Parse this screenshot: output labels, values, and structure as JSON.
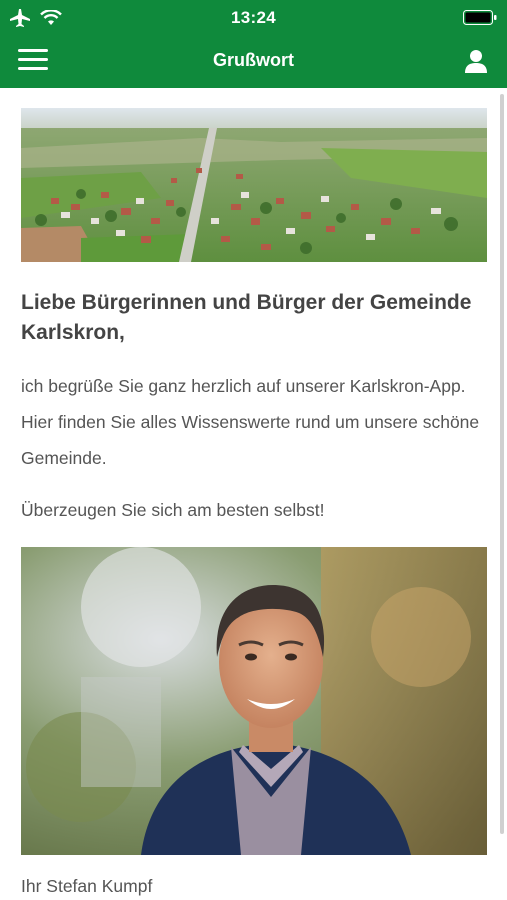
{
  "status_bar": {
    "time": "13:24",
    "icons": [
      "airplane-icon",
      "wifi-icon",
      "battery-icon"
    ]
  },
  "navbar": {
    "title": "Grußwort",
    "left_icon": "hamburger-menu-icon",
    "right_icon": "user-profile-icon"
  },
  "colors": {
    "brand_green": "#0f8a3c",
    "text": "#555555",
    "heading": "#444444"
  },
  "content": {
    "hero_image": "aerial-village-photo",
    "greeting": "Liebe Bürgerinnen und Bürger der Gemeinde Karlskron,",
    "paragraph1": "ich begrüße Sie ganz herzlich auf unserer Karlskron-App. Hier finden Sie alles Wissenswerte rund um unsere schöne Gemeinde.",
    "paragraph2": "Überzeugen Sie sich am besten selbst!",
    "portrait_image": "mayor-portrait-photo",
    "signature": "Ihr Stefan Kumpf"
  }
}
